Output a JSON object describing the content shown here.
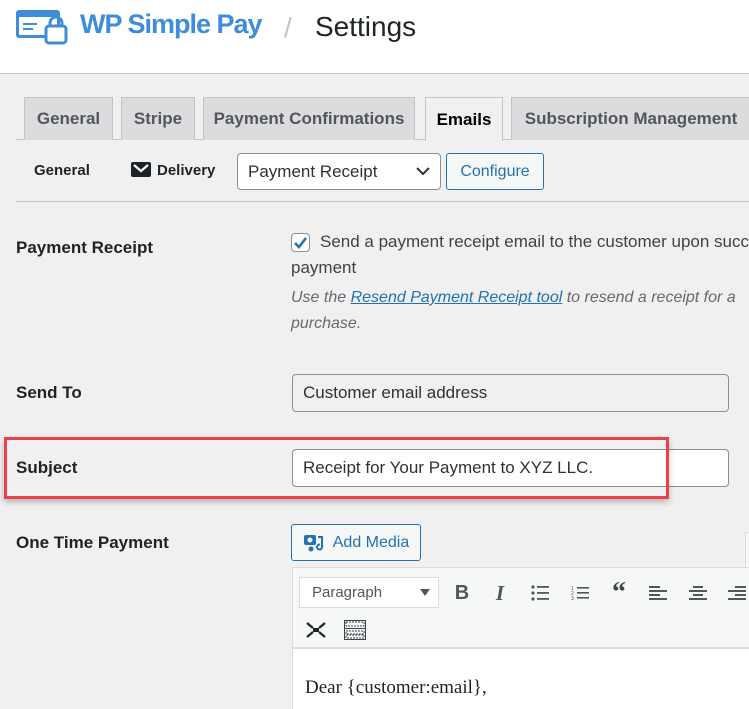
{
  "header": {
    "brand": "WP Simple Pay",
    "separator": "/",
    "title": "Settings",
    "brand_color": "#3f8dd6"
  },
  "tabs": [
    {
      "label": "General",
      "active": false
    },
    {
      "label": "Stripe",
      "active": false
    },
    {
      "label": "Payment Confirmations",
      "active": false
    },
    {
      "label": "Emails",
      "active": true
    },
    {
      "label": "Subscription Management",
      "active": false
    }
  ],
  "subnav": {
    "general": "General",
    "delivery": "Delivery",
    "email_select": {
      "value": "Payment Receipt"
    },
    "configure": "Configure"
  },
  "payment_receipt": {
    "label": "Payment Receipt",
    "checkbox_checked": true,
    "checkbox_text_line1": "Send a payment receipt email to the customer upon successful",
    "checkbox_text_line2": "payment",
    "desc_prefix": "Use the ",
    "desc_link": "Resend Payment Receipt tool",
    "desc_suffix": " to resend a receipt for a",
    "desc_line2": "purchase."
  },
  "send_to": {
    "label": "Send To",
    "value": "Customer email address"
  },
  "subject": {
    "label": "Subject",
    "value": "Receipt for Your Payment to XYZ LLC."
  },
  "one_time_payment": {
    "label": "One Time Payment",
    "add_media": "Add Media",
    "format_select": "Paragraph",
    "toolbar": [
      "bold",
      "italic",
      "bulleted-list",
      "numbered-list",
      "blockquote",
      "align-left",
      "align-center",
      "align-right",
      "fullscreen",
      "toolbar-toggle"
    ],
    "body_text": "Dear {customer:email},"
  },
  "colors": {
    "accent": "#2271b1",
    "highlight": "#e8434a"
  }
}
